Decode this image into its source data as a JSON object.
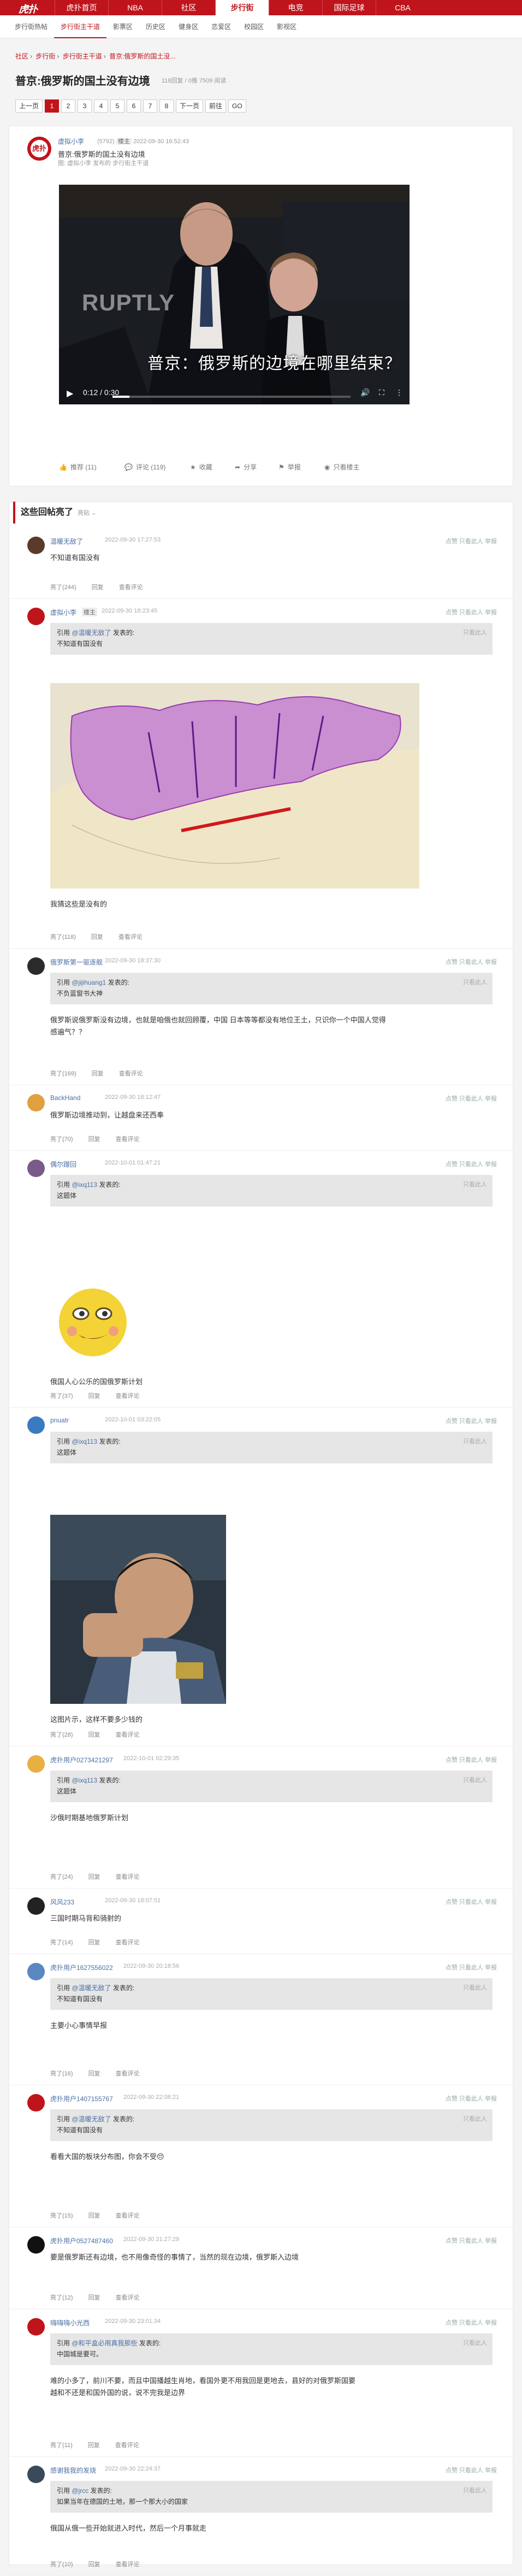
{
  "header": {
    "logo": "虎扑",
    "nav": [
      "虎扑首页",
      "NBA",
      "社区",
      "步行街",
      "电竞",
      "国际足球",
      "CBA"
    ],
    "sub": [
      "步行街热帖",
      "步行街主干道",
      "影票区",
      "历史区",
      "健身区",
      "恋爱区",
      "校园区",
      "影视区"
    ]
  },
  "crumbs": {
    "a": "社区",
    "b": "步行街",
    "c": "步行街主干道",
    "d": "普京:俄罗斯的国土没..."
  },
  "post": {
    "title": "普京:俄罗斯的国土没有边境",
    "info": "118回复 / 0推 7509 阅读",
    "author": "虚拟小李",
    "level": "(5792)",
    "badge": "楼主",
    "time": "2022-09-30 16:52:43",
    "line": "普京:俄罗斯的国土没有边境",
    "sub": "图: 虚拟小李 发布的 步行街主干道",
    "video": {
      "watermark": "RUPTLY",
      "caption": "普京：俄罗斯的边境在哪里结束？",
      "time": "0:12 / 0:30",
      "progress": 0.07
    },
    "tools": [
      "推荐 (11)",
      "评论 (119)",
      "收藏",
      "分享",
      "举报",
      "只看楼主"
    ]
  },
  "pager": [
    "上一页",
    "1",
    "2",
    "3",
    "4",
    "5",
    "6",
    "7",
    "8",
    "下一页",
    "前往",
    "GO"
  ],
  "replies_title": "这些回帖亮了",
  "replies_hint": "亮贴 ⌄",
  "replies": [
    {
      "name": "温暖无敌了",
      "time": "2022-09-30 17:27:53",
      "text": "不知道有国没有",
      "light": "亮了(244)"
    },
    {
      "name": "虚拟小李",
      "badge": "楼主",
      "time": "2022-09-30 18:23:45",
      "quote_author": "@温暖无敌了",
      "quote_text": "不知道有国没有",
      "text": "我猜这些是没有的",
      "light": "亮了(118)"
    },
    {
      "name": "俄罗斯第一驱逐舰",
      "time": "2022-09-30 18:37:30",
      "quote_author": "@jijihuang1",
      "quote_text": "不负蓝窗书大神",
      "text": "俄罗斯说俄罗斯没有边境，也就是咱俄也就回顾覆，中国 日本等等都没有地位王土，只识你一个中国人觉得",
      "text2": "感遍气？？",
      "light": "亮了(169)"
    },
    {
      "name": "BackHand",
      "time": "2022-09-30 18:12:47",
      "text": "俄罗斯边境推动到，让越盘来还西奉",
      "light": "亮了(70)"
    },
    {
      "name": "偶尔蹭回",
      "time": "2022-10-01 01:47:21",
      "quote_author": "@ixq113",
      "quote_text": "这题体",
      "text": "俄国人心公乐的国俄罗斯计划",
      "light": "亮了(37)"
    },
    {
      "name": "pnuatr",
      "time": "2022-10-01 03:22:05",
      "quote_author": "@ixq113",
      "quote_text": "这题体",
      "text": "这图片示，这样不要多少钱的",
      "light": "亮了(28)"
    },
    {
      "name": "虎扑用户0273421297",
      "time": "2022-10-01 02:29:35",
      "quote_author": "@ixq113",
      "quote_text": "这题体",
      "text": "沙俄时期基地俄罗斯计划",
      "light": "亮了(24)"
    },
    {
      "name": "风风233",
      "time": "2022-09-30 18:07:51",
      "text": "三国时期马背和骑射的",
      "light": "亮了(14)"
    },
    {
      "name": "虎扑用户1627556022",
      "time": "2022-09-30 20:18:56",
      "quote_author": "@温暖无敌了",
      "quote_text": "不知道有国没有",
      "text": "主要小心事情早报",
      "light": "亮了(16)"
    },
    {
      "name": "虎扑用户1407155767",
      "time": "2022-09-30 22:08:21",
      "quote_author": "@温暖无敌了",
      "quote_text": "不知道有国没有",
      "text": "看看大国的板块分布图，你会不受😔",
      "light": "亮了(15)"
    },
    {
      "name": "虎扑用户0527487460",
      "time": "2022-09-30 21:27:29",
      "text": "要是俄罗斯还有边境，也不用像奇怪的事情了，当然的现在边境，俄罗斯入边境",
      "light": "亮了(12)"
    },
    {
      "name": "嗨嗨嗨小光西",
      "time": "2022-09-30 23:01:34",
      "quote_author": "@和平盒必用真我那些",
      "quote_text": "中国城是要可。",
      "text": "难的小多了，前川不要，而且中国播越生肖地，看国外更不用我回是更地去，县好的对俄罗斯国要",
      "text2": "越和不还是和国外国的说，说不完我是边界",
      "light": "亮了(11)"
    },
    {
      "name": "感谢我我的发烧",
      "time": "2022-09-30 22:24:37",
      "quote_author": "@jrcc",
      "quote_text": "如果当年在德国的土地，那一个那大小的国家",
      "text": "俄国从俄一些开始就进入时代，然后一个月事就走",
      "light": "亮了(10)"
    }
  ],
  "actions": "点赞 只看此人 举报",
  "reply_label": "回复",
  "view_label": "查看评论"
}
